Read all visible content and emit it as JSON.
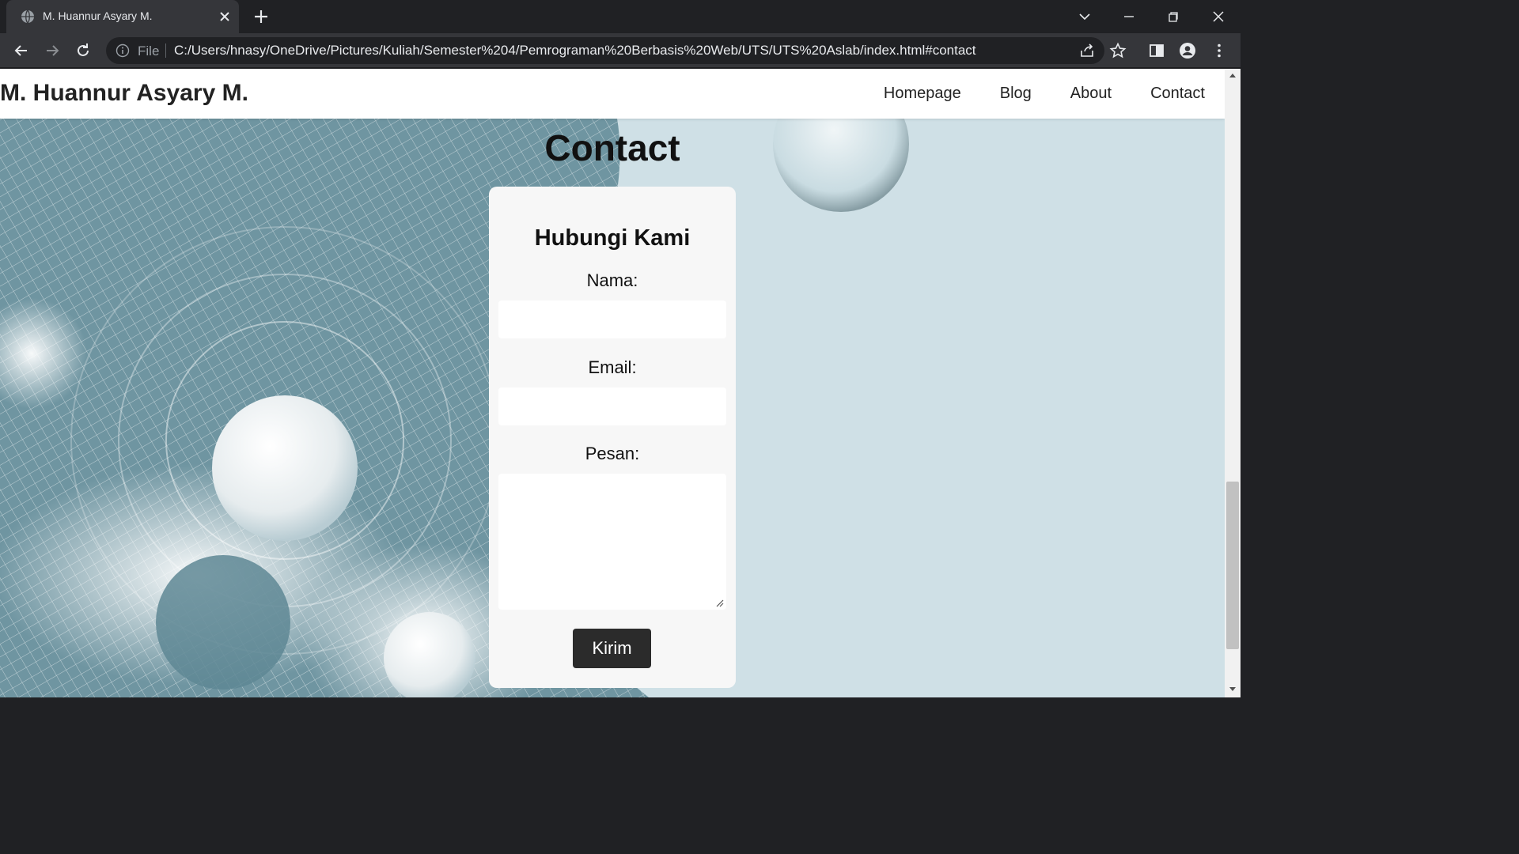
{
  "browser": {
    "tab_title": "M. Huannur Asyary M.",
    "omnibox_scheme": "File",
    "url": "C:/Users/hnasy/OneDrive/Pictures/Kuliah/Semester%204/Pemrograman%20Berbasis%20Web/UTS/UTS%20Aslab/index.html#contact"
  },
  "site": {
    "title": "M. Huannur Asyary M.",
    "nav": [
      "Homepage",
      "Blog",
      "About",
      "Contact"
    ]
  },
  "contact": {
    "section_title": "Contact",
    "heading": "Hubungi Kami",
    "name_label": "Nama:",
    "email_label": "Email:",
    "message_label": "Pesan:",
    "submit_label": "Kirim"
  }
}
